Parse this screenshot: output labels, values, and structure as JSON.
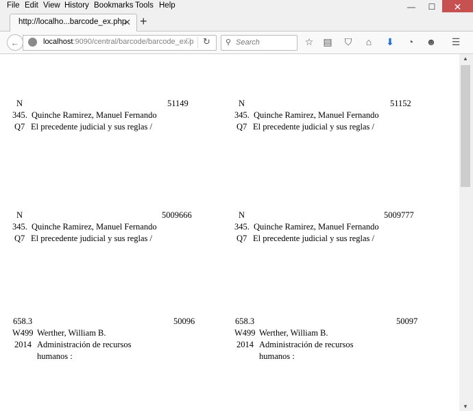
{
  "menu": [
    "File",
    "Edit",
    "View",
    "History",
    "Bookmarks",
    "Tools",
    "Help"
  ],
  "window_buttons": {
    "minimize": "—",
    "maximize": "☐",
    "close": "✕"
  },
  "tab": {
    "title": "http://localho...barcode_ex.php",
    "close": "✕"
  },
  "new_tab": "+",
  "nav": {
    "back": "←",
    "url_host": "localhost",
    "url_path": ":9090/central/barcode/barcode_ex.p",
    "reload": "↻",
    "search_placeholder": "Search"
  },
  "toolbar_icons": [
    "star-icon",
    "reading-list-icon",
    "pocket-icon",
    "home-icon",
    "download-icon",
    "history-icon",
    "chat-icon",
    "hamburger-menu-icon"
  ],
  "labels": [
    {
      "call1": "N",
      "call2": "345.",
      "call3": "Q7",
      "barcode": "51149",
      "author": "Quinche Ramirez, Manuel Fernando",
      "title1": "El precedente judicial y sus reglas /",
      "title2": ""
    },
    {
      "call1": "N",
      "call2": "345.",
      "call3": "Q7",
      "barcode": "51152",
      "author": "Quinche Ramirez, Manuel Fernando",
      "title1": "El precedente judicial y sus reglas /",
      "title2": ""
    },
    {
      "call1": "N",
      "call2": "345.",
      "call3": "Q7",
      "barcode": "5009666",
      "author": "Quinche Ramirez, Manuel Fernando",
      "title1": "El precedente judicial y sus reglas /",
      "title2": ""
    },
    {
      "call1": "N",
      "call2": "345.",
      "call3": "Q7",
      "barcode": "5009777",
      "author": "Quinche Ramirez, Manuel Fernando",
      "title1": "El precedente judicial y sus reglas /",
      "title2": ""
    },
    {
      "call1": "658.3",
      "call2": "W499",
      "call3": "2014",
      "barcode": "50096",
      "author": "Werther, William B.",
      "title1": "Administración de recursos",
      "title2": "humanos :"
    },
    {
      "call1": "658.3",
      "call2": "W499",
      "call3": "2014",
      "barcode": "50097",
      "author": "Werther, William B.",
      "title1": "Administración de recursos",
      "title2": "humanos :"
    }
  ]
}
